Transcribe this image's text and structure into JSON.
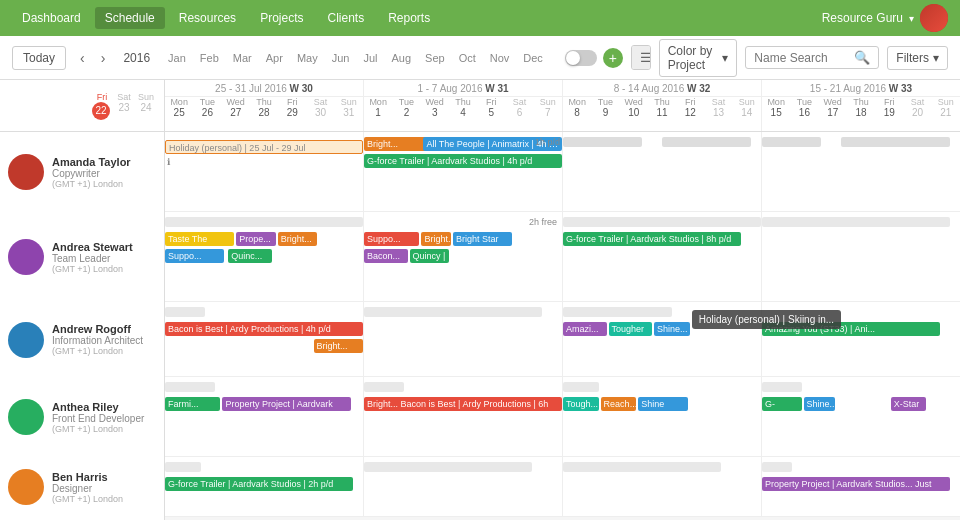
{
  "nav": {
    "items": [
      "Dashboard",
      "Schedule",
      "Resources",
      "Projects",
      "Clients",
      "Reports"
    ],
    "active": "Schedule",
    "user": "Resource Guru",
    "brand_color": "#6ab04c"
  },
  "toolbar": {
    "today": "Today",
    "year": "2016",
    "months": [
      "Jan",
      "Feb",
      "Mar",
      "Apr",
      "May",
      "Jun",
      "Jul",
      "Aug",
      "Sep",
      "Oct",
      "Nov",
      "Dec"
    ],
    "color_by": "Color by Project",
    "search_placeholder": "Name Search",
    "filters": "Filters"
  },
  "weeks": [
    {
      "label": "25 - 31 Jul 2016",
      "week_num": "W 30",
      "days": [
        {
          "name": "Mon",
          "num": "25"
        },
        {
          "name": "Tue",
          "num": "26"
        },
        {
          "name": "Wed",
          "num": "27"
        },
        {
          "name": "Thu",
          "num": "28"
        },
        {
          "name": "Fri",
          "num": "29"
        },
        {
          "name": "Sat",
          "num": "30"
        },
        {
          "name": "Sun",
          "num": "31"
        }
      ]
    },
    {
      "label": "1 - 7 Aug 2016",
      "week_num": "W 31",
      "days": [
        {
          "name": "Mon",
          "num": "1"
        },
        {
          "name": "Tue",
          "num": "2"
        },
        {
          "name": "Wed",
          "num": "3"
        },
        {
          "name": "Thu",
          "num": "4"
        },
        {
          "name": "Fri",
          "num": "5"
        },
        {
          "name": "Sat",
          "num": "6"
        },
        {
          "name": "Sun",
          "num": "7"
        }
      ]
    },
    {
      "label": "8 - 14 Aug 2016",
      "week_num": "W 32",
      "days": [
        {
          "name": "Mon",
          "num": "8"
        },
        {
          "name": "Tue",
          "num": "9"
        },
        {
          "name": "Wed",
          "num": "10"
        },
        {
          "name": "Thu",
          "num": "11"
        },
        {
          "name": "Fri",
          "num": "12"
        },
        {
          "name": "Sat",
          "num": "13"
        },
        {
          "name": "Sun",
          "num": "14"
        }
      ]
    },
    {
      "label": "15 - 21 Aug 2016",
      "week_num": "W 33",
      "days": [
        {
          "name": "Mon",
          "num": "15"
        },
        {
          "name": "Tue",
          "num": "16"
        },
        {
          "name": "Wed",
          "num": "17"
        },
        {
          "name": "Thu",
          "num": "18"
        },
        {
          "name": "Fri",
          "num": "19"
        },
        {
          "name": "Sat",
          "num": "20"
        },
        {
          "name": "Sun",
          "num": "21"
        }
      ]
    }
  ],
  "prev_week": {
    "days": [
      {
        "name": "Fri",
        "num": "22",
        "today": true
      },
      {
        "name": "Sat",
        "num": "23"
      },
      {
        "name": "Sun",
        "num": "24"
      }
    ]
  },
  "people": [
    {
      "name": "Amanda Taylor",
      "role": "Copywriter",
      "tz": "(GMT +1) London",
      "avatar_color": "#c0392b"
    },
    {
      "name": "Andrea Stewart",
      "role": "Team Leader",
      "tz": "(GMT +1) London",
      "avatar_color": "#8e44ad"
    },
    {
      "name": "Andrew Rogoff",
      "role": "Information Architect",
      "tz": "(GMT +1) London",
      "avatar_color": "#2980b9"
    },
    {
      "name": "Anthea Riley",
      "role": "Front End Developer",
      "tz": "(GMT +1) London",
      "avatar_color": "#27ae60"
    },
    {
      "name": "Ben Harris",
      "role": "Designer",
      "tz": "(GMT +1) London",
      "avatar_color": "#e67e22"
    }
  ]
}
